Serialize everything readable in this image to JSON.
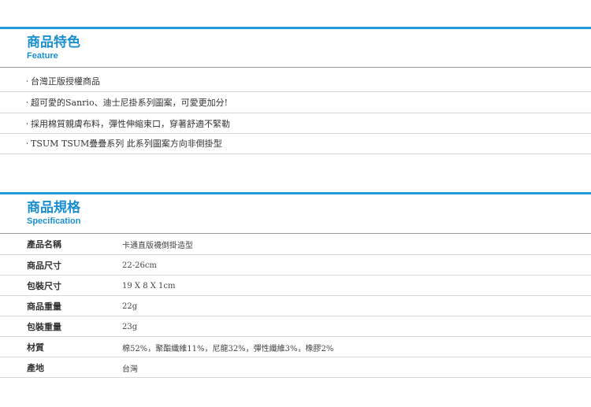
{
  "feature": {
    "title": "商品特色",
    "subtitle": "Feature",
    "bullet": "‧",
    "items": [
      "台灣正版授權商品",
      "超可愛的Sanrio、迪士尼掛系列圖案，可愛更加分!",
      "採用棉質親膚布料，彈性伸縮束口，穿著舒適不緊勒",
      "TSUM TSUM疊疊系列 此系列圖案方向非倒掛型"
    ]
  },
  "specification": {
    "title": "商品規格",
    "subtitle": "Specification",
    "rows": [
      {
        "label": "產品名稱",
        "value": "卡通直版襪倒掛造型"
      },
      {
        "label": "商品尺寸",
        "value": "22-26cm"
      },
      {
        "label": "包裝尺寸",
        "value": "19 X 8 X 1cm"
      },
      {
        "label": "商品重量",
        "value": "22g"
      },
      {
        "label": "包裝重量",
        "value": "23g"
      },
      {
        "label": "材質",
        "value": "棉52%，聚酯纖維11%，尼龍32%，彈性纖維3%，橡膠2%"
      },
      {
        "label": "產地",
        "value": "台灣"
      }
    ]
  },
  "colors": {
    "accent": "#1e9bd8",
    "title": "#1a8fd0",
    "row_shade": "#f4f4f4",
    "rule": "#d6d6d6"
  }
}
